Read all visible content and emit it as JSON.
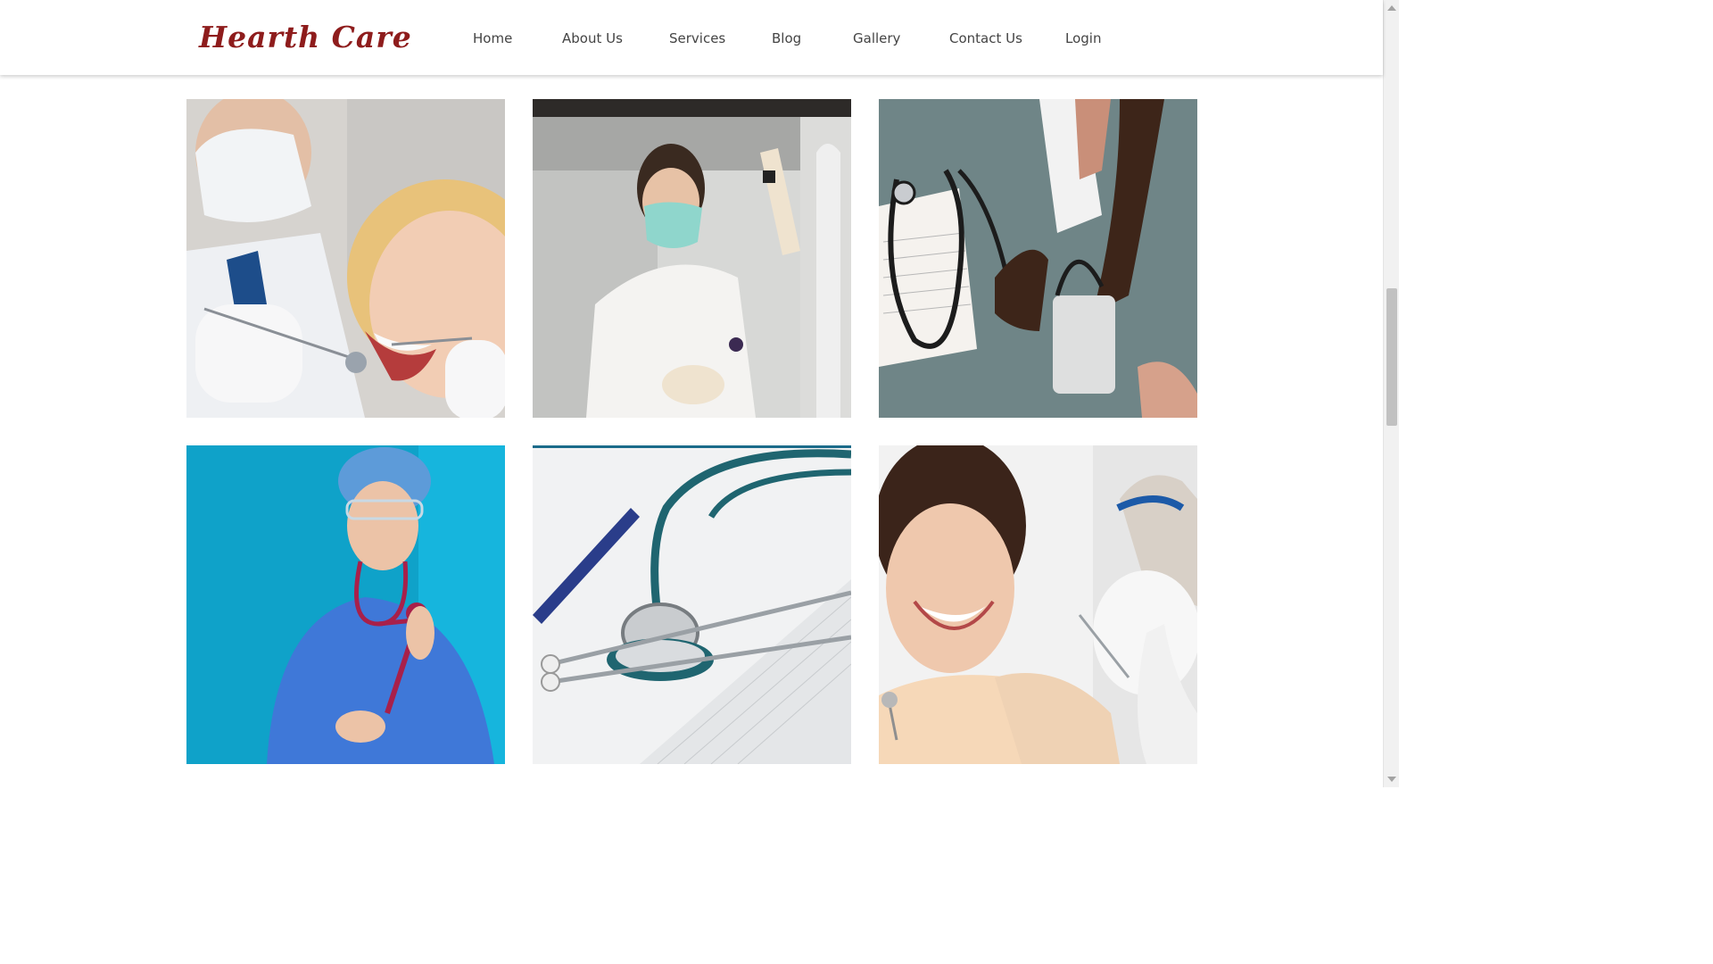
{
  "brand": {
    "logo_text": "Hearth Care",
    "logo_color": "#8e1c1c"
  },
  "nav": {
    "items": [
      {
        "label": "Home"
      },
      {
        "label": "About Us"
      },
      {
        "label": "Services"
      },
      {
        "label": "Blog"
      },
      {
        "label": "Gallery"
      },
      {
        "label": "Contact Us"
      },
      {
        "label": "Login"
      }
    ]
  },
  "gallery": {
    "images": [
      {
        "subject": "dentist examining smiling patient"
      },
      {
        "subject": "lab technician in mask holding sample"
      },
      {
        "subject": "blood pressure measurement with stethoscope"
      },
      {
        "subject": "nurse in surgical scrubs holding stethoscope"
      },
      {
        "subject": "stethoscope and pen on medical form"
      },
      {
        "subject": "smiling dental patient"
      }
    ]
  },
  "scrollbar": {
    "position_fraction": 0.44
  }
}
